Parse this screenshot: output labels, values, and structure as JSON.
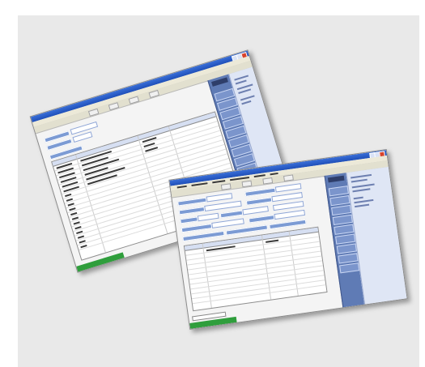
{
  "scene": {
    "description_items": [
      "back-window",
      "front-window"
    ]
  },
  "colors": {
    "titlebar": "#2b5dc8",
    "sidebar": "#5f7bb5",
    "field_label": "#7c9bd4",
    "statusbar": "#2f9e3c",
    "backdrop": "#e9e9e9"
  }
}
